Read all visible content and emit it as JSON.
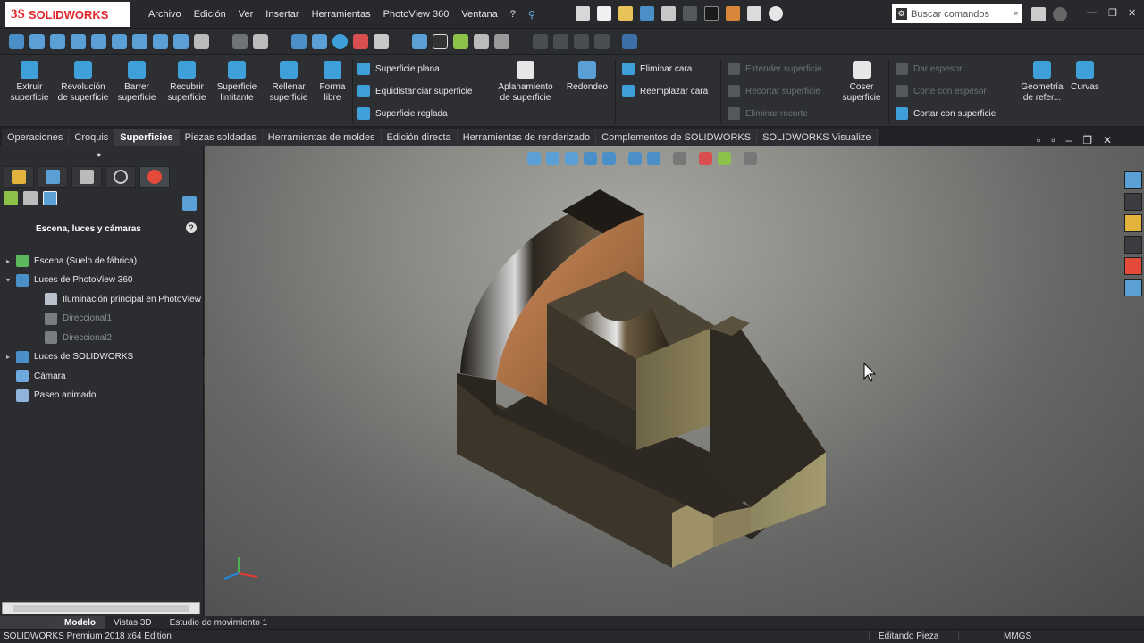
{
  "app": {
    "logo_ds": "3S",
    "logo_name": "SOLIDWORKS"
  },
  "menu": [
    "Archivo",
    "Edición",
    "Ver",
    "Insertar",
    "Herramientas",
    "PhotoView 360",
    "Ventana",
    "?"
  ],
  "search": {
    "placeholder": "Buscar comandos"
  },
  "ribbon": {
    "big": [
      {
        "label": "Extruir superficie",
        "color": "#3fa0d9"
      },
      {
        "label": "Revolución de superficie",
        "color": "#3fa0d9"
      },
      {
        "label": "Barrer superficie",
        "color": "#3fa0d9"
      },
      {
        "label": "Recubrir superficie",
        "color": "#3fa0d9"
      },
      {
        "label": "Superficie limitante",
        "color": "#3fa0d9"
      },
      {
        "label": "Rellenar superficie",
        "color": "#3fa0d9"
      },
      {
        "label": "Forma libre",
        "color": "#3fa0d9"
      }
    ],
    "group2": [
      "Superficie plana",
      "Equidistanciar superficie",
      "Superficie reglada"
    ],
    "aplanamiento": "Aplanamiento de superficie",
    "redondeo": "Redondeo",
    "group3": [
      "Eliminar cara",
      "Reemplazar cara"
    ],
    "group4_dim": [
      "Extender superficie",
      "Recortar superficie",
      "Eliminar recorte"
    ],
    "coser": "Coser superficie",
    "group5": [
      "Dar espesor",
      "Corte con espesor",
      "Cortar con superficie"
    ],
    "geometria": "Geometría de refer...",
    "curvas": "Curvas"
  },
  "tabs": [
    "Operaciones",
    "Croquis",
    "Superficies",
    "Piezas soldadas",
    "Herramientas de moldes",
    "Edición directa",
    "Herramientas de renderizado",
    "Complementos de SOLIDWORKS",
    "SOLIDWORKS Visualize"
  ],
  "active_tab": "Superficies",
  "panel": {
    "title": "Escena, luces y cámaras",
    "help": "?",
    "tree": [
      {
        "label": "Escena (Suelo de fábrica)",
        "arrow": "▸",
        "color": "#5cb85c",
        "dim": false
      },
      {
        "label": "Luces de PhotoView 360",
        "arrow": "▾",
        "color": "#4a8fc7",
        "dim": false
      },
      {
        "label": "Iluminación principal en PhotoView",
        "arrow": "",
        "color": "#b9c2cc",
        "dim": false
      },
      {
        "label": "Direccional1",
        "arrow": "",
        "color": "#7a7d82",
        "dim": true
      },
      {
        "label": "Direccional2",
        "arrow": "",
        "color": "#7a7d82",
        "dim": true
      },
      {
        "label": "Luces de SOLIDWORKS",
        "arrow": "▸",
        "color": "#4a8fc7",
        "dim": false
      },
      {
        "label": "Cámara",
        "arrow": "",
        "color": "#6fa8dc",
        "dim": false
      },
      {
        "label": "Paseo animado",
        "arrow": "",
        "color": "#8fb3d9",
        "dim": false
      }
    ]
  },
  "bottom_tabs": [
    "Modelo",
    "Vistas 3D",
    "Estudio de movimiento 1"
  ],
  "active_bottom": "Modelo",
  "status": {
    "edition": "SOLIDWORKS Premium 2018 x64 Edition",
    "mode": "Editando Pieza",
    "units": "MMGS"
  }
}
